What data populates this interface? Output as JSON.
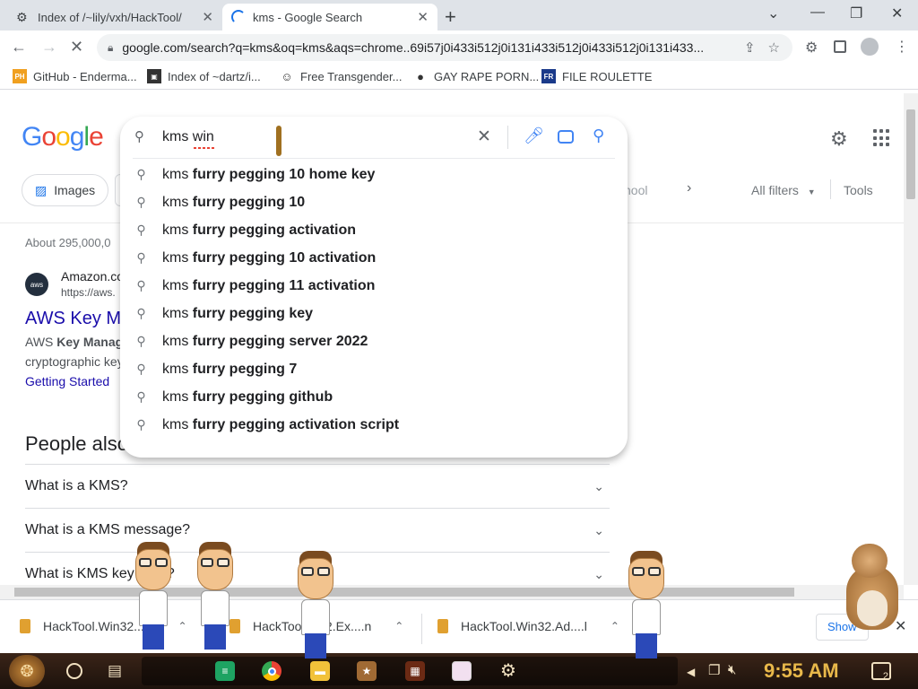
{
  "tabs": [
    {
      "title": "Index of /~lily/vxh/HackTool/",
      "active": false
    },
    {
      "title": "kms - Google Search",
      "active": true
    }
  ],
  "omnibox": {
    "url": "google.com/search?q=kms&oq=kms&aqs=chrome..69i57j0i433i512j0i131i433i512j0i433i512j0i131i433..."
  },
  "bookmarks": [
    {
      "label": "GitHub - Enderma...",
      "icon": "PH"
    },
    {
      "label": "Index of ~dartz/i...",
      "icon": "image-icon"
    },
    {
      "label": "Free Transgender...",
      "icon": "mask-icon"
    },
    {
      "label": "GAY RAPE PORN...",
      "icon": "globe-icon"
    },
    {
      "label": "FILE ROULETTE",
      "icon": "FR"
    }
  ],
  "search": {
    "query": "kms win",
    "suggestions": [
      {
        "prefix": "kms ",
        "bold": "furry pegging 10 home key"
      },
      {
        "prefix": "kms ",
        "bold": "furry pegging 10"
      },
      {
        "prefix": "kms ",
        "bold": "furry pegging activation"
      },
      {
        "prefix": "kms ",
        "bold": "furry pegging 10 activation"
      },
      {
        "prefix": "kms ",
        "bold": "furry pegging 11 activation"
      },
      {
        "prefix": "kms ",
        "bold": "furry pegging key"
      },
      {
        "prefix": "kms ",
        "bold": "furry pegging server 2022"
      },
      {
        "prefix": "kms ",
        "bold": "furry pegging 7"
      },
      {
        "prefix": "kms ",
        "bold": "furry pegging github"
      },
      {
        "prefix": "kms ",
        "bold": "furry pegging activation script"
      }
    ]
  },
  "logo": [
    "G",
    "o",
    "o",
    "g",
    "l",
    "e"
  ],
  "chips": {
    "images": "Images",
    "school": "hool"
  },
  "filters": {
    "all": "All filters",
    "tools": "Tools"
  },
  "results": {
    "stats": "About 295,000,0",
    "site": "Amazon.co",
    "url": "https://aws.",
    "title": "AWS Key Ma",
    "snippet1_pre": "AWS ",
    "snippet1_bold": "Key Manage",
    "snippet2": "cryptographic key",
    "link": "Getting Started"
  },
  "paa": {
    "heading": "People also",
    "questions": [
      "What is a KMS?",
      "What is a KMS message?",
      "What is KMS key",
      "?"
    ]
  },
  "downloads": [
    {
      "name": "HackTool.Win32....b"
    },
    {
      "name": "HackTool....32.Ex....n"
    },
    {
      "name": "HackTool.Win32.Ad....l"
    }
  ],
  "download_bar": {
    "show_all": "Show"
  },
  "taskbar": {
    "clock": "9:55 AM",
    "notifications": "2"
  },
  "colors": {
    "accent": "#1a73e8",
    "link": "#1a0dab",
    "taskbar": "#2a1a10"
  }
}
